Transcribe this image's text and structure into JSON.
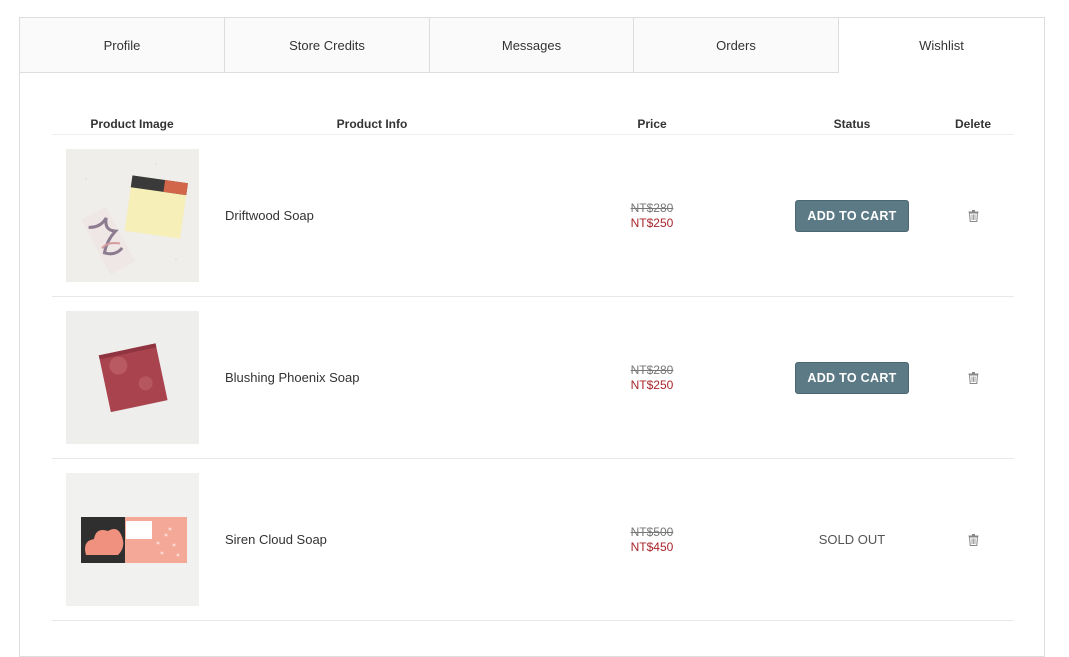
{
  "tabs": [
    {
      "label": "Profile"
    },
    {
      "label": "Store Credits"
    },
    {
      "label": "Messages"
    },
    {
      "label": "Orders"
    },
    {
      "label": "Wishlist"
    }
  ],
  "active_tab": "Wishlist",
  "table": {
    "headers": {
      "image": "Product Image",
      "info": "Product Info",
      "price": "Price",
      "status": "Status",
      "delete": "Delete"
    },
    "rows": [
      {
        "name": "Driftwood Soap",
        "price_original": "NT$280",
        "price_sale": "NT$250",
        "status": "ADD TO CART",
        "icon": "trash-icon"
      },
      {
        "name": "Blushing Phoenix Soap",
        "price_original": "NT$280",
        "price_sale": "NT$250",
        "status": "ADD TO CART",
        "icon": "trash-icon"
      },
      {
        "name": "Siren Cloud Soap",
        "price_original": "NT$500",
        "price_sale": "NT$450",
        "status": "SOLD OUT",
        "icon": "trash-icon"
      }
    ]
  },
  "colors": {
    "button": "#5b7a85",
    "sale_price": "#a8262b",
    "border": "#dddddd"
  }
}
